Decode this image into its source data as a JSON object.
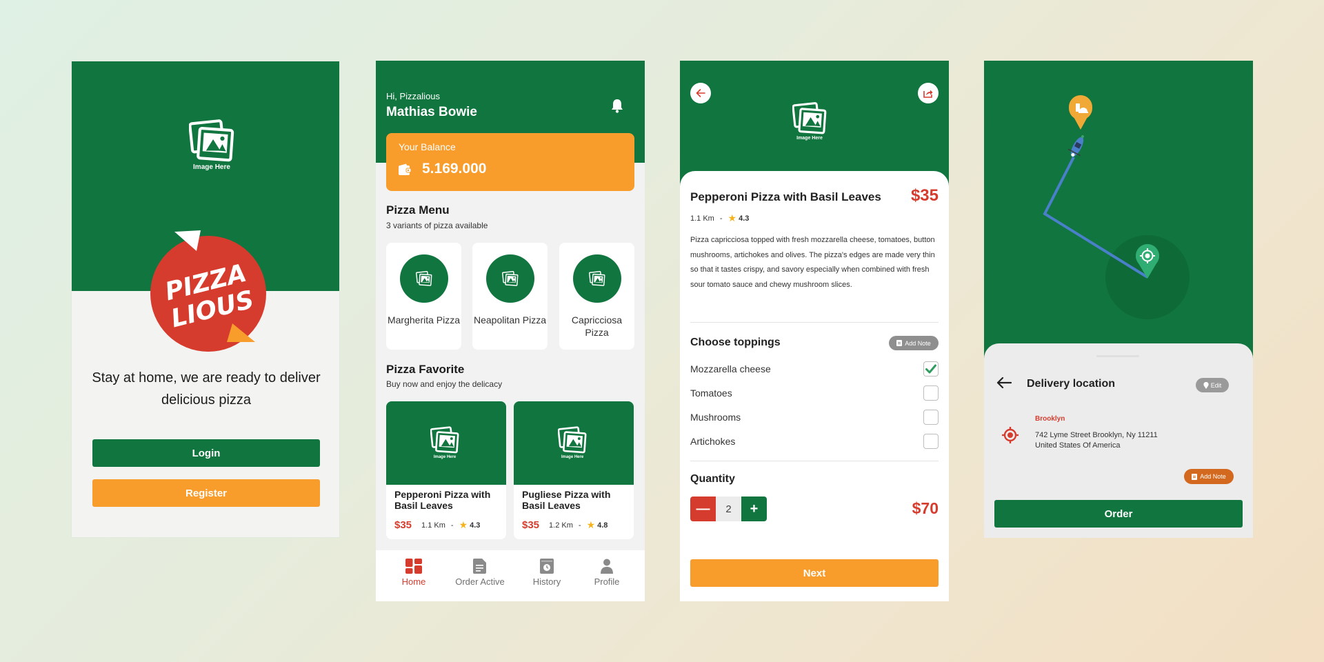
{
  "colors": {
    "primary_green": "#10753e",
    "accent_orange": "#f89c2c",
    "accent_red": "#d63c2e",
    "star_yellow": "#f6b21a",
    "check_green": "#2e9b5f"
  },
  "placeholder_label": "Image Here",
  "splash": {
    "logo_line1": "PIZZA",
    "logo_line2": "LIOUS",
    "tagline": "Stay at home, we are ready to deliver delicious pizza",
    "login_label": "Login",
    "register_label": "Register"
  },
  "home": {
    "greeting": "Hi, Pizzalious",
    "user_name": "Mathias Bowie",
    "balance_label": "Your Balance",
    "balance_value": "5.169.000",
    "menu_title": "Pizza Menu",
    "menu_subtitle": "3 variants of pizza available",
    "menu_items": [
      {
        "name": "Margherita Pizza"
      },
      {
        "name": "Neapolitan Pizza"
      },
      {
        "name": "Capricciosa Pizza"
      }
    ],
    "favorite_title": "Pizza Favorite",
    "favorite_subtitle": "Buy now and enjoy the delicacy",
    "favorites": [
      {
        "name": "Pepperoni Pizza with Basil Leaves",
        "price": "$35",
        "distance": "1.1 Km",
        "separator": "-",
        "rating": "4.3"
      },
      {
        "name": "Pugliese Pizza with Basil Leaves",
        "price": "$35",
        "distance": "1.2 Km",
        "separator": "-",
        "rating": "4.8"
      }
    ],
    "nav": [
      {
        "label": "Home",
        "icon": "grid-icon",
        "active": true
      },
      {
        "label": "Order Active",
        "icon": "document-icon",
        "active": false
      },
      {
        "label": "History",
        "icon": "history-book-icon",
        "active": false
      },
      {
        "label": "Profile",
        "icon": "user-icon",
        "active": false
      }
    ]
  },
  "detail": {
    "title": "Pepperoni Pizza with Basil Leaves",
    "price": "$35",
    "distance": "1.1 Km",
    "separator": "-",
    "rating": "4.3",
    "description": "Pizza capricciosa topped with fresh mozzarella cheese, tomatoes, button mushrooms, artichokes and olives. The pizza's edges are made very thin so that it tastes crispy, and savory especially when combined with fresh sour tomato sauce and chewy mushroom slices.",
    "toppings_title": "Choose toppings",
    "add_note_label": "Add Note",
    "toppings": [
      {
        "name": "Mozzarella cheese",
        "checked": true
      },
      {
        "name": "Tomatoes",
        "checked": false
      },
      {
        "name": "Mushrooms",
        "checked": false
      },
      {
        "name": "Artichokes",
        "checked": false
      }
    ],
    "quantity_label": "Quantity",
    "quantity_minus": "—",
    "quantity_plus": "+",
    "quantity_value": "2",
    "total": "$70",
    "next_label": "Next"
  },
  "delivery": {
    "title": "Delivery location",
    "edit_label": "Edit",
    "city": "Brooklyn",
    "address_line1": "742 Lyme Street Brooklyn, Ny 11211",
    "address_line2": "United States Of America",
    "add_note_label": "Add Note",
    "order_label": "Order"
  }
}
